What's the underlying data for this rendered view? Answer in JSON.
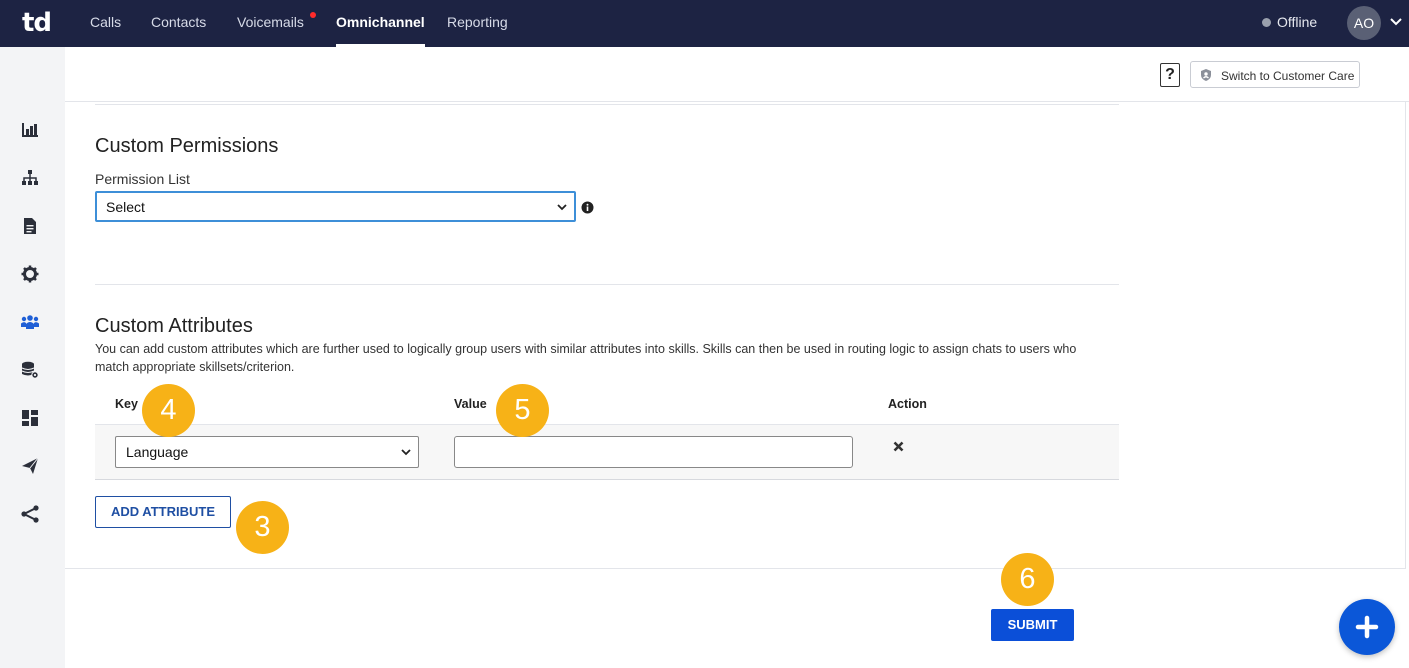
{
  "app": {
    "logo": "td"
  },
  "nav": {
    "items": [
      {
        "label": "Calls"
      },
      {
        "label": "Contacts"
      },
      {
        "label": "Voicemails"
      },
      {
        "label": "Omnichannel"
      },
      {
        "label": "Reporting"
      }
    ],
    "active": "Omnichannel",
    "status": "Offline",
    "avatar": "AO"
  },
  "sidebar": {
    "icons": [
      "bar-chart-icon",
      "org-chart-icon",
      "document-icon",
      "gear-icon",
      "users-icon",
      "database-settings-icon",
      "dashboard-icon",
      "send-icon",
      "share-icon"
    ],
    "active_icon": "users-icon"
  },
  "header": {
    "help": "?",
    "switch_label": "Switch to Customer Care"
  },
  "permissions": {
    "title": "Custom Permissions",
    "list_label": "Permission List",
    "selected": "Select"
  },
  "attributes": {
    "title": "Custom Attributes",
    "description": "You can add custom attributes which are further used to logically group users with similar attributes into skills. Skills can then be used in routing logic to assign chats to users who match appropriate skillsets/criterion.",
    "columns": {
      "key": "Key",
      "value": "Value",
      "action": "Action"
    },
    "rows": [
      {
        "key": "Language",
        "value": ""
      }
    ],
    "add_button": "ADD ATTRIBUTE"
  },
  "submit_label": "SUBMIT",
  "markers": {
    "add": "3",
    "key": "4",
    "value": "5",
    "submit": "6"
  },
  "colors": {
    "topbar": "#1d2343",
    "primary": "#0b4fd8",
    "marker": "#f7b217",
    "notification": "#ff2b2b"
  }
}
